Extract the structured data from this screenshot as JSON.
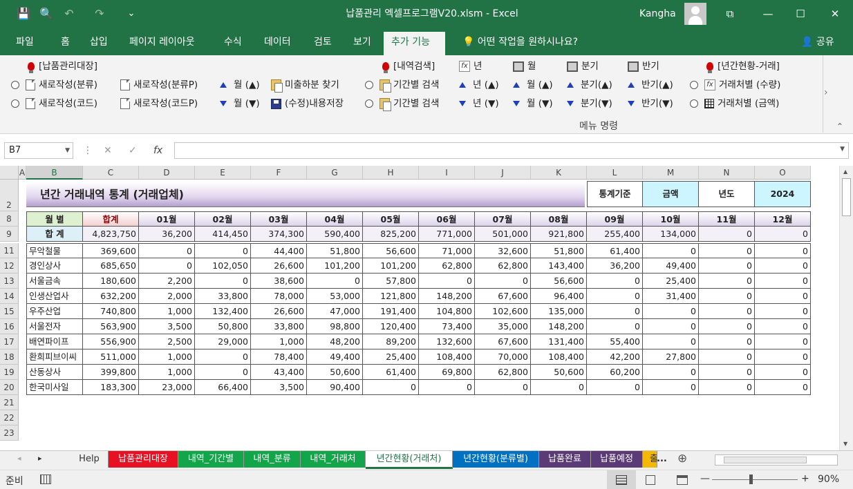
{
  "window": {
    "title": "납품관리 엑셀프로그램V20.xlsm  -  Excel",
    "user": "Kangha",
    "qat": {
      "save": "💾",
      "preview": "🔍",
      "undo": "↶",
      "redo": "↷",
      "more": "⌄"
    },
    "controls": {
      "ribbon_display": "⧉",
      "minimize": "—",
      "maximize": "☐",
      "close": "✕"
    }
  },
  "tabs": [
    "파일",
    "홈",
    "삽입",
    "페이지 레이아웃",
    "수식",
    "데이터",
    "검토",
    "보기",
    "추가 기능"
  ],
  "tell_me": "어떤 작업을 원하시나요?",
  "share": "공유",
  "ribbon": {
    "delivery_ledger": "[납품관리대장]",
    "new_category": "새로작성(분류)",
    "new_category_p": "새로작성(분류P)",
    "new_code": "새로작성(코드)",
    "new_code_p": "새로작성(코드P)",
    "month_up": "월 (▲)",
    "month_down": "월 (▼)",
    "find_undelivered": "미출하분 찾기",
    "save_edits": "(수정)내용저장",
    "history_search": "[내역검색]",
    "period_search": "기간별 검색",
    "year": "년",
    "month": "월",
    "quarter": "분기",
    "half": "반기",
    "year_up": "년 (▲)",
    "year_down": "년 (▼)",
    "month_up2": "월 (▲)",
    "month_down2": "월 (▼)",
    "quarter_up": "분기(▲)",
    "quarter_down": "분기(▼)",
    "half_up": "반기(▲)",
    "half_down": "반기(▼)",
    "annual_trade": "[년간현황-거래]",
    "by_vendor_qty": "거래처별 (수량)",
    "by_vendor_amount": "거래처별 (금액)",
    "group_label": "메뉴 명령",
    "expand": "›",
    "collapse": "⌃"
  },
  "formula_bar": {
    "name_box": "B7",
    "cancel": "✕",
    "enter": "✓",
    "fx": "fx",
    "value": ""
  },
  "grid": {
    "columns": [
      "A",
      "B",
      "C",
      "D",
      "E",
      "F",
      "G",
      "H",
      "I",
      "J",
      "K",
      "L",
      "M",
      "N",
      "O"
    ],
    "row_numbers": [
      "2",
      "8",
      "9",
      "11",
      "12",
      "13",
      "14",
      "15",
      "16",
      "17",
      "18",
      "19",
      "20",
      "21",
      "22",
      "23"
    ]
  },
  "report": {
    "title": "년간 거래내역 통계 (거래업체)",
    "basis_label": "통계기준",
    "basis_value": "금액",
    "year_label": "년도",
    "year_value": "2024",
    "month_header": "월      별",
    "total_header": "합계",
    "months": [
      "01월",
      "02월",
      "03월",
      "04월",
      "05월",
      "06월",
      "07월",
      "08월",
      "09월",
      "10월",
      "11월",
      "12월"
    ],
    "sum_label": "합      계",
    "grand_total": "4,823,750",
    "month_totals": [
      "36,200",
      "414,450",
      "374,300",
      "590,400",
      "825,200",
      "771,000",
      "501,000",
      "921,800",
      "255,400",
      "134,000",
      "0",
      "0"
    ],
    "rows": [
      {
        "name": "무악철물",
        "total": "369,600",
        "values": [
          "0",
          "0",
          "44,400",
          "51,800",
          "56,600",
          "71,000",
          "32,600",
          "51,800",
          "61,400",
          "0",
          "0",
          "0"
        ]
      },
      {
        "name": "경인상사",
        "total": "685,650",
        "values": [
          "0",
          "102,050",
          "26,600",
          "101,200",
          "101,200",
          "62,800",
          "62,800",
          "143,400",
          "36,200",
          "49,400",
          "0",
          "0"
        ]
      },
      {
        "name": "서울금속",
        "total": "180,600",
        "values": [
          "2,200",
          "0",
          "38,600",
          "0",
          "57,800",
          "0",
          "0",
          "56,600",
          "0",
          "25,400",
          "0",
          "0"
        ]
      },
      {
        "name": "인생산업사",
        "total": "632,200",
        "values": [
          "2,000",
          "33,800",
          "78,000",
          "53,000",
          "121,800",
          "148,200",
          "67,600",
          "96,400",
          "0",
          "31,400",
          "0",
          "0"
        ]
      },
      {
        "name": "우주산업",
        "total": "740,800",
        "values": [
          "1,000",
          "132,400",
          "26,600",
          "47,000",
          "191,400",
          "104,800",
          "102,600",
          "135,000",
          "0",
          "0",
          "0",
          "0"
        ]
      },
      {
        "name": "서울전자",
        "total": "563,900",
        "values": [
          "3,500",
          "50,800",
          "33,800",
          "98,800",
          "120,400",
          "73,400",
          "35,000",
          "148,200",
          "0",
          "0",
          "0",
          "0"
        ]
      },
      {
        "name": "배연파이프",
        "total": "556,900",
        "values": [
          "2,500",
          "29,000",
          "1,000",
          "48,200",
          "89,200",
          "132,600",
          "67,600",
          "131,400",
          "55,400",
          "0",
          "0",
          "0"
        ]
      },
      {
        "name": "환희피브이씨",
        "total": "511,000",
        "values": [
          "1,000",
          "0",
          "78,400",
          "49,400",
          "25,400",
          "108,400",
          "70,000",
          "108,400",
          "42,200",
          "27,800",
          "0",
          "0"
        ]
      },
      {
        "name": "산동상사",
        "total": "399,800",
        "values": [
          "1,000",
          "0",
          "43,400",
          "50,600",
          "61,400",
          "69,800",
          "62,800",
          "50,600",
          "60,200",
          "0",
          "0",
          "0"
        ]
      },
      {
        "name": "한국미사일",
        "total": "183,300",
        "values": [
          "23,000",
          "66,400",
          "3,500",
          "90,400",
          "0",
          "0",
          "0",
          "0",
          "0",
          "0",
          "0",
          "0"
        ]
      }
    ]
  },
  "sheet_tabs": [
    {
      "label": "Help",
      "color": "#f0f0f0",
      "text": "#333"
    },
    {
      "label": "납품관리대장",
      "color": "#e81123",
      "text": "#ffffff"
    },
    {
      "label": "내역_기간별",
      "color": "#13a54a",
      "text": "#ffffff"
    },
    {
      "label": "내역_분류",
      "color": "#13a54a",
      "text": "#ffffff"
    },
    {
      "label": "내역_거래처",
      "color": "#13a54a",
      "text": "#ffffff"
    },
    {
      "label": "년간현황(거래처)",
      "color": "#ffffff",
      "text": "#217346"
    },
    {
      "label": "년간현황(분류별)",
      "color": "#0070c0",
      "text": "#ffffff"
    },
    {
      "label": "납품완료",
      "color": "#5b3a78",
      "text": "#ffffff"
    },
    {
      "label": "납품예정",
      "color": "#5b3a78",
      "text": "#ffffff"
    },
    {
      "label": "출",
      "color": "#f5b800",
      "text": "#333"
    }
  ],
  "sheet_nav": {
    "prev": "◂",
    "next": "▸",
    "more": "...",
    "add": "⊕"
  },
  "status": {
    "ready": "준비",
    "zoom": "90%",
    "minus": "—",
    "plus": "+"
  },
  "colors": {
    "excel_green": "#217346",
    "selected_tab_bg": "#f3f3f3"
  }
}
